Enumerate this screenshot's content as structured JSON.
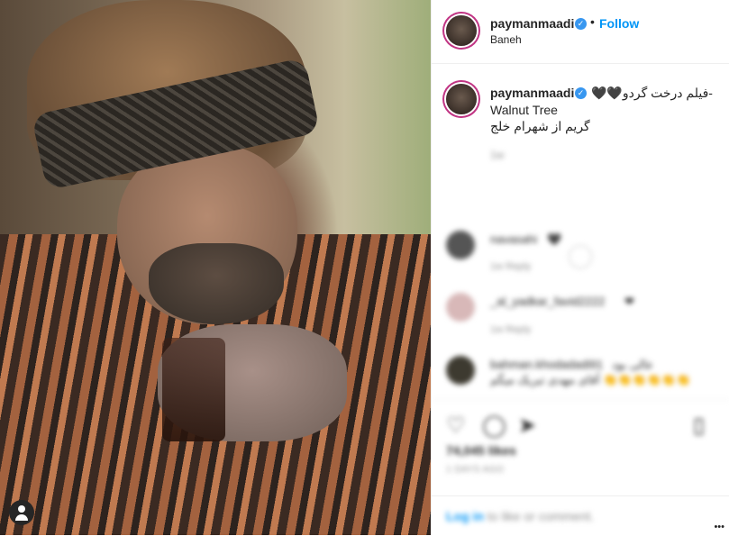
{
  "post": {
    "username": "paymanmaadi",
    "verified_badge": "✓",
    "follow_label": "Follow",
    "separator": "•",
    "location": "Baneh",
    "more_options": "•••"
  },
  "caption": {
    "username": "paymanmaadi",
    "verified_badge": "✓",
    "line1": "-فیلم درخت گردو🖤🖤",
    "line2": "Walnut Tree",
    "line3": "گریم از شهرام خلج"
  },
  "blurred": {
    "caption_meta": "1w",
    "comments": [
      {
        "user": "navasahi",
        "text": "🖤",
        "meta": "1w   Reply"
      },
      {
        "user": "_al_yadkar_favid2222",
        "text": "❤",
        "meta": "1w   Reply"
      },
      {
        "user": "bahman.khodadadi91",
        "text": "عالی بود",
        "line2": "آقای مهدی تبریک میگم 👏👏👏👏👏👏",
        "meta": ""
      }
    ],
    "likes": "74,045 likes",
    "date": "1 DAYS AGO",
    "login_link": "Log in",
    "login_rest": " to like or comment."
  },
  "icons": {
    "heart": "heart-icon",
    "comment": "comment-icon",
    "share": "share-icon",
    "save": "bookmark-icon",
    "tag": "user-tag-icon",
    "load_more": "plus-circle-icon"
  },
  "colors": {
    "link_blue": "#0095f6",
    "verified_blue": "#3897f0",
    "ring": "#c13584",
    "muted": "#8e8e8e"
  }
}
